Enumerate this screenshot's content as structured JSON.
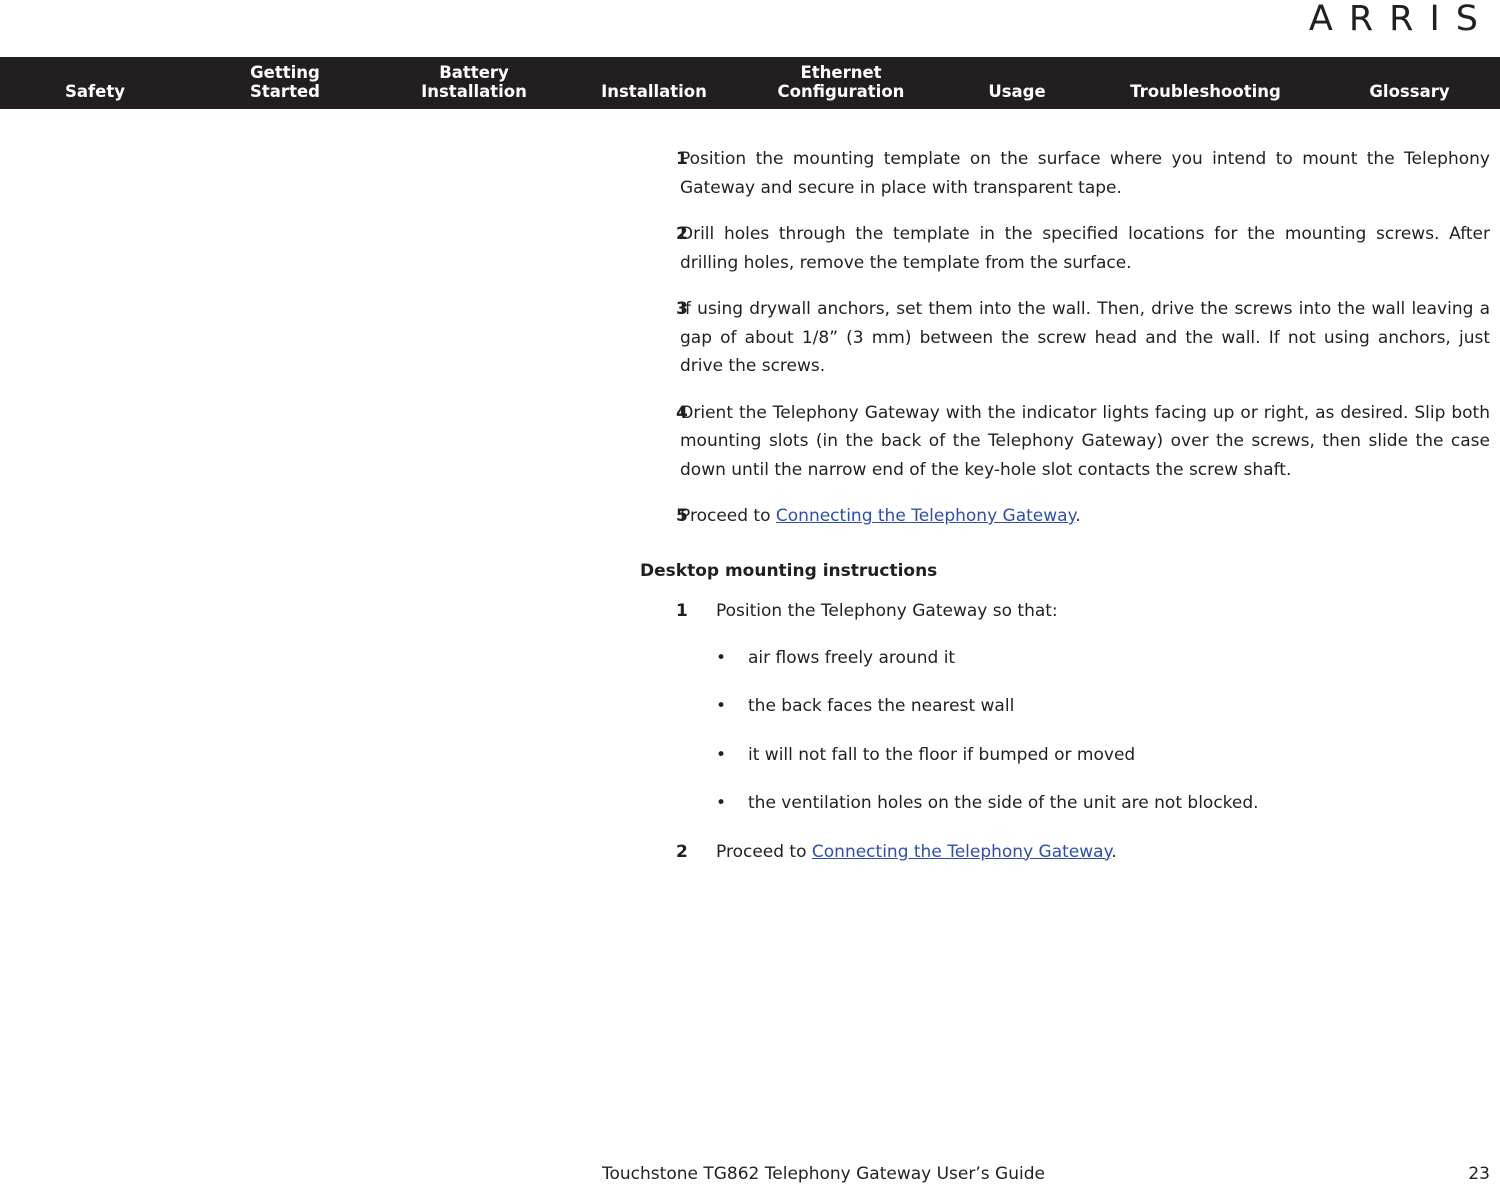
{
  "logo": {
    "text": "ARRIS"
  },
  "nav": {
    "tabs": [
      {
        "id": "safety",
        "label": "Safety"
      },
      {
        "id": "getting-started",
        "label": "Getting\nStarted"
      },
      {
        "id": "battery-installation",
        "label": "Battery\nInstallation"
      },
      {
        "id": "installation",
        "label": "Installation"
      },
      {
        "id": "ethernet-configuration",
        "label": "Ethernet\nConfiguration"
      },
      {
        "id": "usage",
        "label": "Usage"
      },
      {
        "id": "troubleshooting",
        "label": "Troubleshooting"
      },
      {
        "id": "glossary",
        "label": "Glossary"
      }
    ],
    "background_color": "#231f20",
    "text_color": "#ffffff"
  },
  "wall_mounting": {
    "steps": [
      {
        "num": "1",
        "text": "Position the mounting template on the surface where you intend to mount the Telephony Gateway and secure in place with transparent tape."
      },
      {
        "num": "2",
        "text": "Drill holes through the template in the specified locations for the mounting screws. After drilling holes, remove the template from the surface."
      },
      {
        "num": "3",
        "text": "If using drywall anchors, set them into the wall. Then, drive the screws into the wall leaving a gap of about 1/8” (3 mm) between the screw head and the wall. If not using anchors, just drive the screws."
      },
      {
        "num": "4",
        "text": "Orient the Telephony Gateway with the indicator lights facing up or right, as desired. Slip both mounting slots (in the back of the Telephony Gateway) over the screws, then slide the case down until the narrow end of the key-hole slot contacts the screw shaft."
      }
    ],
    "final_step": {
      "num": "5",
      "prefix": "Proceed to ",
      "link": "Connecting the Telephony Gateway",
      "suffix": "."
    }
  },
  "desktop_mounting": {
    "heading": "Desktop mounting instructions",
    "step1": {
      "num": "1",
      "text": "Position the Telephony Gateway so that:"
    },
    "bullets": [
      {
        "marker": "•",
        "text": "air flows freely around it"
      },
      {
        "marker": "•",
        "text": "the back faces the nearest wall"
      },
      {
        "marker": "•",
        "text": "it will not fall to the floor if bumped or moved"
      },
      {
        "marker": "•",
        "text": "the ventilation holes on the side of the unit are not blocked."
      }
    ],
    "step2": {
      "num": "2",
      "prefix": "Proceed to ",
      "link": "Connecting the Telephony Gateway",
      "suffix": "."
    }
  },
  "footer": {
    "title": "Touchstone TG862 Telephony Gateway User’s Guide",
    "page": "23"
  },
  "colors": {
    "link": "#2e4fa8",
    "text": "#231f20",
    "nav_bg": "#231f20"
  }
}
